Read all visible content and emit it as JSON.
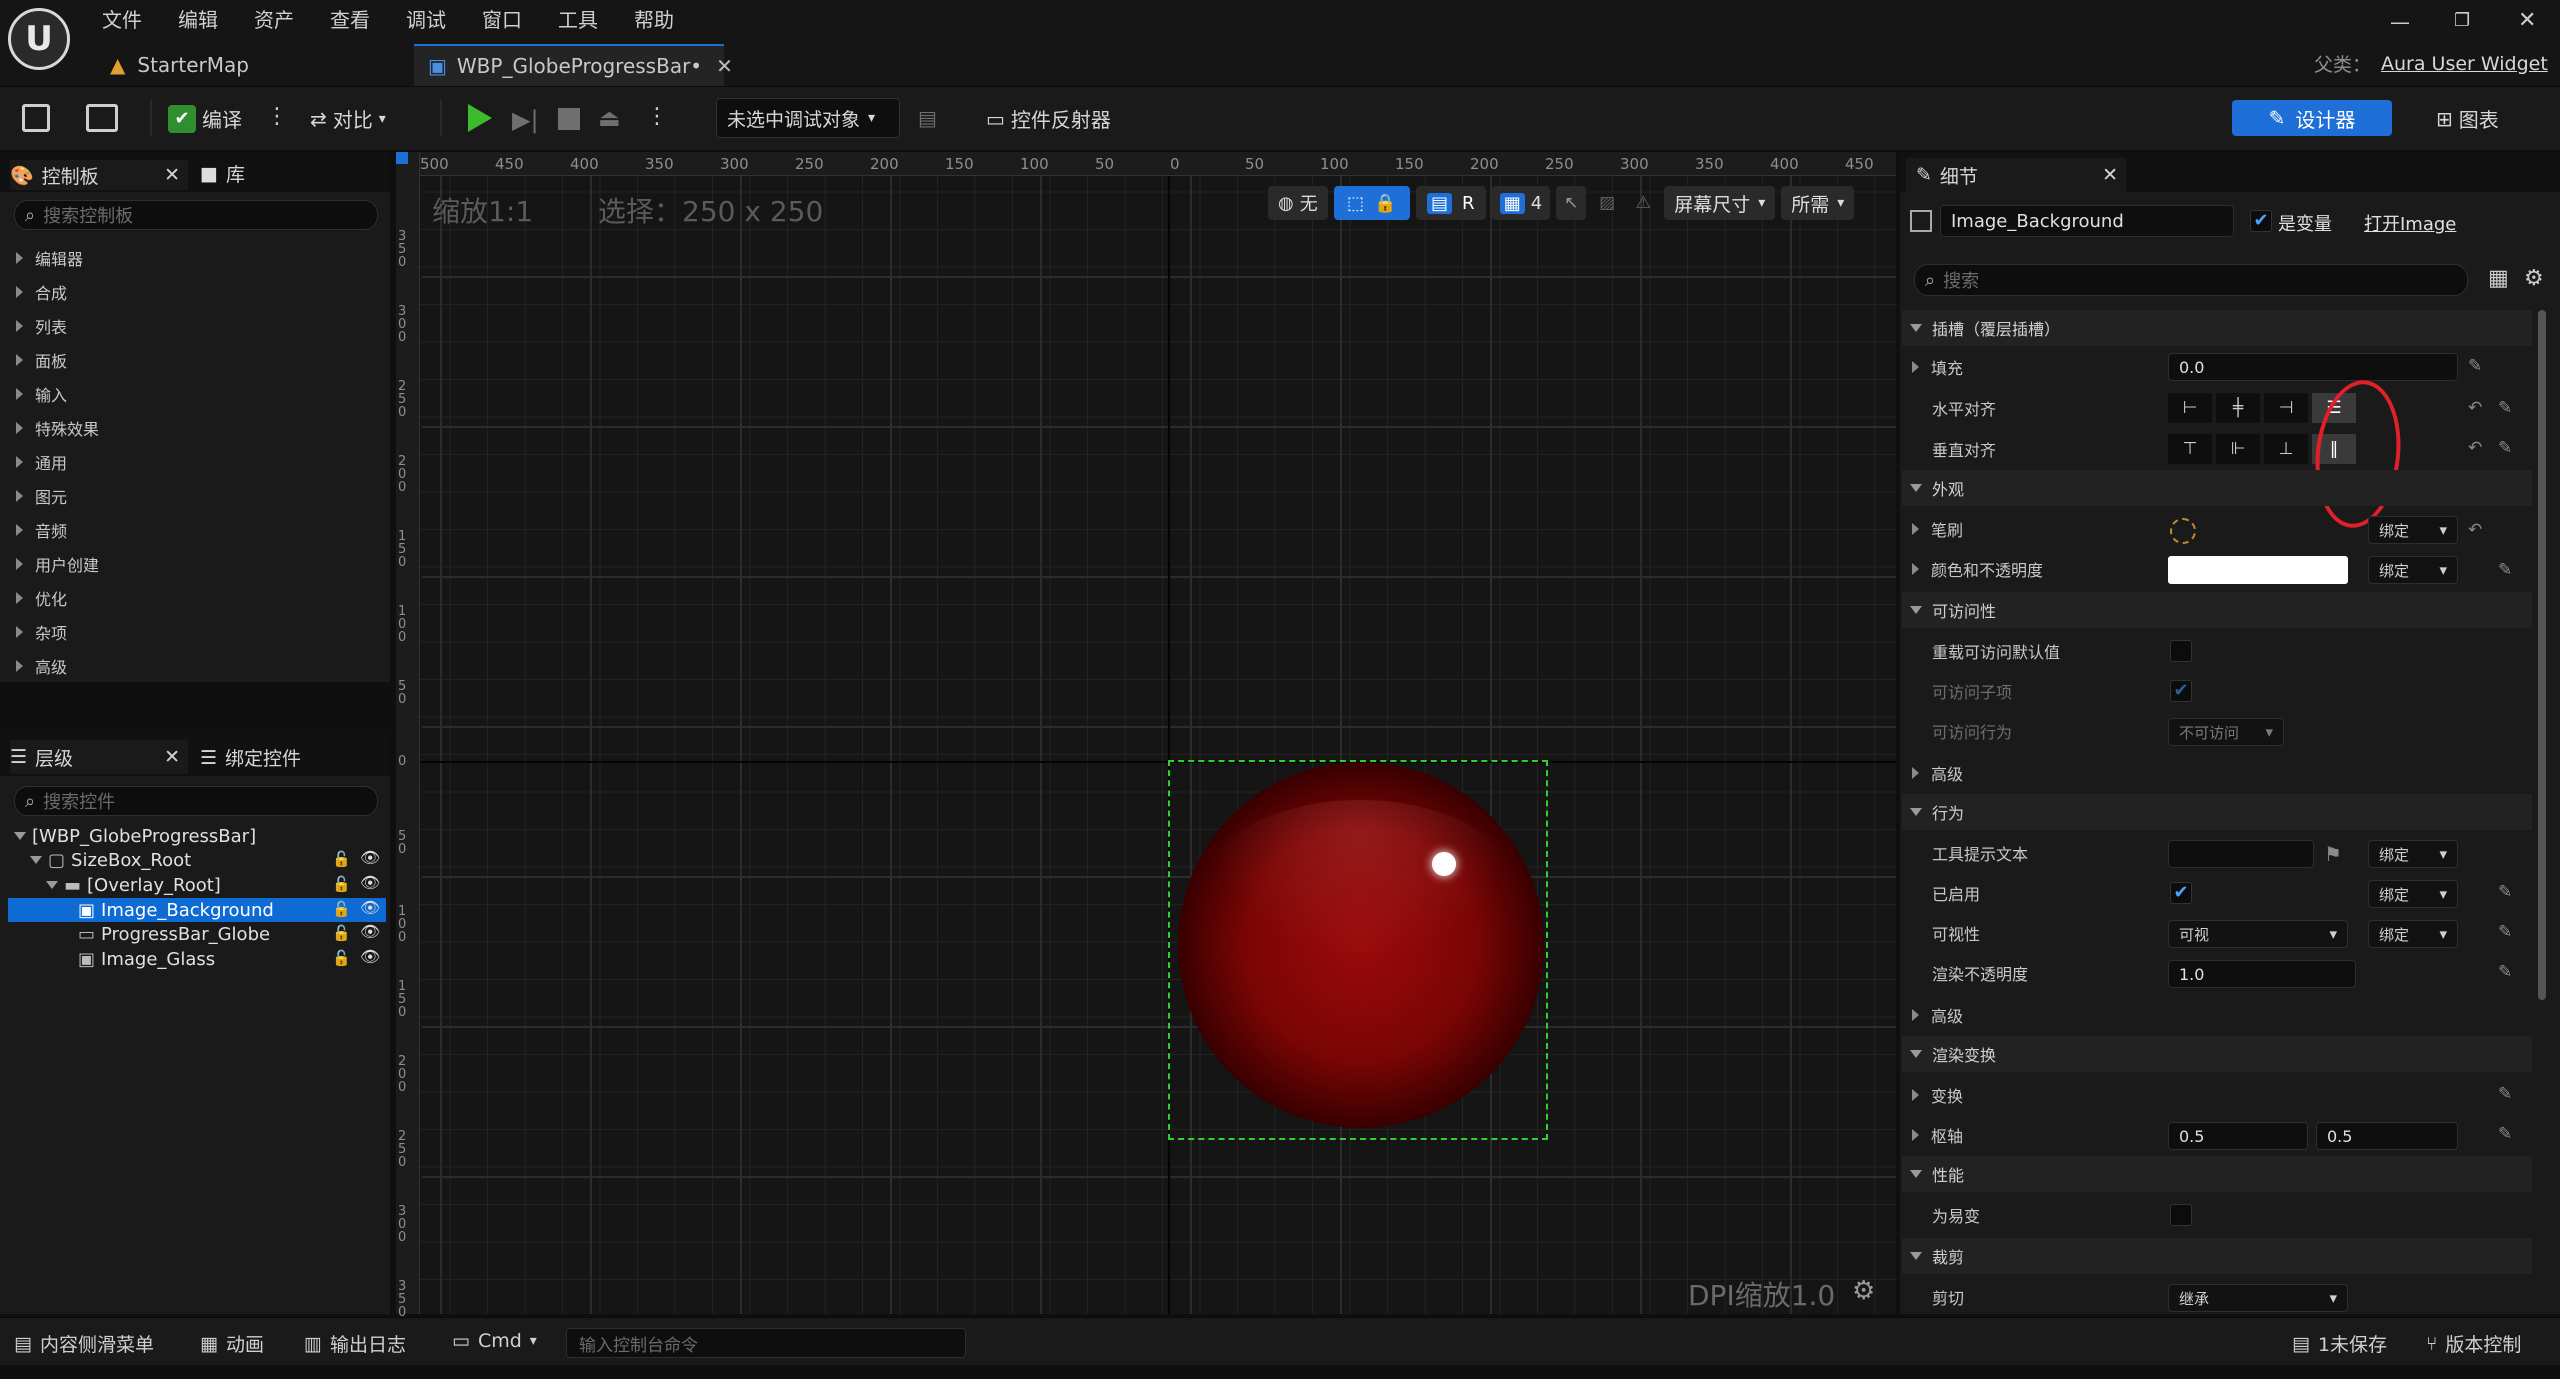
{
  "menu": [
    "文件",
    "编辑",
    "资产",
    "查看",
    "调试",
    "窗口",
    "工具",
    "帮助"
  ],
  "tabs": {
    "map": "StarterMap",
    "widget": "WBP_GlobeProgressBar•"
  },
  "parent": {
    "label": "父类：",
    "value": "Aura User Widget"
  },
  "toolbar": {
    "compile": "编译",
    "diff": "对比",
    "debug_target": "未选中调试对象",
    "reflector": "控件反射器",
    "designer": "设计器",
    "graph": "图表"
  },
  "palette": {
    "tab_palette": "控制板",
    "tab_library": "库",
    "search_placeholder": "搜索控制板",
    "categories": [
      "编辑器",
      "合成",
      "列表",
      "面板",
      "输入",
      "特殊效果",
      "通用",
      "图元",
      "音频",
      "用户创建",
      "优化",
      "杂项",
      "高级"
    ]
  },
  "hierarchy": {
    "tab_hierarchy": "层级",
    "tab_bind": "绑定控件",
    "search_placeholder": "搜索控件",
    "items": [
      "[WBP_GlobeProgressBar]",
      "SizeBox_Root",
      "[Overlay_Root]",
      "Image_Background",
      "ProgressBar_Globe",
      "Image_Glass"
    ]
  },
  "viewport": {
    "zoom": "缩放1:1",
    "selection": "选择：250 x 250",
    "dpi": "DPI缩放1.0",
    "btn_none": "无",
    "btn_r": "R",
    "grid_count": "4",
    "screen_size": "屏幕尺寸",
    "fill_mode": "所需",
    "ruler_top": [
      "500",
      "450",
      "400",
      "350",
      "300",
      "250",
      "200",
      "150",
      "100",
      "50",
      "0",
      "50",
      "100",
      "150",
      "200",
      "250",
      "300",
      "350",
      "400",
      "450"
    ],
    "ruler_left": [
      "350",
      "300",
      "250",
      "200",
      "150",
      "100",
      "50",
      "0",
      "50",
      "100",
      "150",
      "200",
      "250",
      "300",
      "350"
    ]
  },
  "details": {
    "tab": "细节",
    "widget_name": "Image_Background",
    "is_variable": "是变量",
    "open": "打开Image",
    "search_placeholder": "搜索",
    "sections": {
      "slot": "插槽（覆层插槽）",
      "padding": "填充",
      "padding_value": "0.0",
      "h_align": "水平对齐",
      "v_align": "垂直对齐",
      "appearance": "外观",
      "brush": "笔刷",
      "bind": "绑定",
      "color": "颜色和不透明度",
      "accessibility": "可访问性",
      "override_access": "重载可访问默认值",
      "access_children": "可访问子项",
      "access_behavior": "可访问行为",
      "not_accessible": "不可访问",
      "advanced": "高级",
      "behavior": "行为",
      "tooltip": "工具提示文本",
      "enabled": "已启用",
      "visibility": "可视性",
      "visible": "可视",
      "render_opacity": "渲染不透明度",
      "render_opacity_value": "1.0",
      "render_transform": "渲染变换",
      "transform": "变换",
      "pivot": "枢轴",
      "pivot_x": "0.5",
      "pivot_y": "0.5",
      "performance": "性能",
      "volatile": "为易变",
      "clipping": "裁剪",
      "clip": "剪切",
      "inherit": "继承"
    }
  },
  "bottombar": {
    "content_drawer": "内容侧滑菜单",
    "animation": "动画",
    "output_log": "输出日志",
    "cmd": "Cmd",
    "console_placeholder": "输入控制台命令",
    "unsaved": "1未保存",
    "source_control": "版本控制"
  },
  "colors": {
    "accent": "#1f6fd8",
    "selection": "#0d6bd3",
    "green_play": "#3dbb2c",
    "annotation": "#e0202a"
  }
}
